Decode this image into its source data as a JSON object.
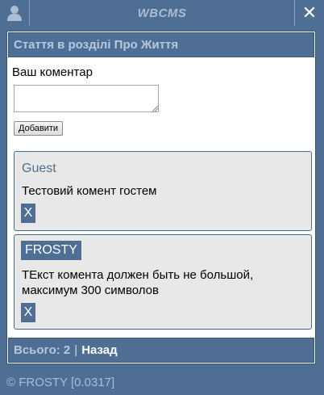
{
  "topbar": {
    "brand": "WBCMS",
    "user_icon": "user-icon",
    "close_label": "✕"
  },
  "panel": {
    "title": "Стаття в розділі Про Життя",
    "comment_label": "Ваш коментар",
    "comment_value": "",
    "add_button": "Добавити"
  },
  "comments": [
    {
      "author": "Guest",
      "text": "Тестовий комент гостем",
      "delete_label": "X"
    },
    {
      "author": "FROSTY",
      "text": "ТЕкст комента должен быть не большой, максимум 300 символов",
      "delete_label": "X"
    }
  ],
  "footer_bar": {
    "total": "Всього: 2",
    "separator": "|",
    "back": "Назад"
  },
  "copyright": "© FROSTY [0.0317]",
  "colors": {
    "primary": "#4e6e94",
    "muted_text": "#b6c8de",
    "comment_bg": "#e8e8e8"
  }
}
